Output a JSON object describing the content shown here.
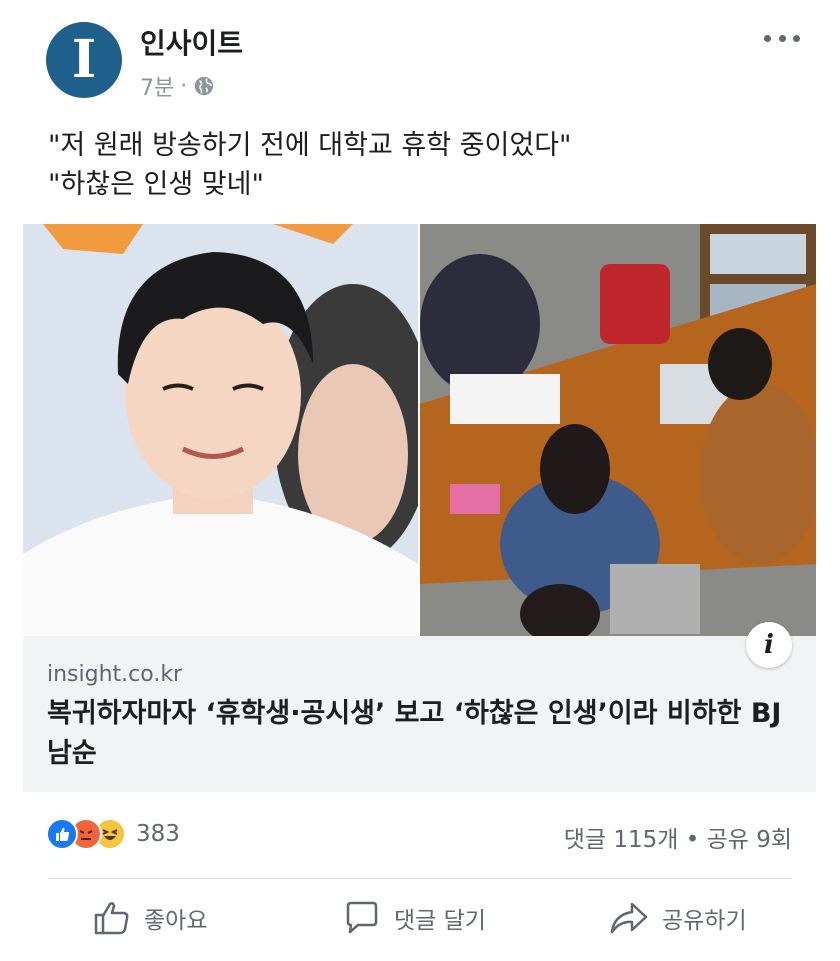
{
  "post": {
    "page_name": "인사이트",
    "avatar_letter": "I",
    "time": "7분",
    "privacy_icon": "globe-icon",
    "text": "\"저 원래 방송하기 전에 대학교 휴학 중이었다\"\n\"하찮은 인생 맞네\""
  },
  "link": {
    "domain": "insight.co.kr",
    "headline": "복귀하자마자 ‘휴학생·공시생’ 보고 ‘하찮은 인생’이라 비하한 BJ 남순",
    "info_icon": "i"
  },
  "stats": {
    "reaction_icons": [
      "like-icon",
      "angry-icon",
      "haha-icon"
    ],
    "reaction_count": "383",
    "comments_shares": "댓글 115개 • 공유 9회"
  },
  "actions": {
    "like": "좋아요",
    "comment": "댓글 달기",
    "share": "공유하기"
  },
  "colors": {
    "avatar_bg": "#1e5f8c",
    "like_blue": "#1877f2",
    "angry_orange": "#f0653b",
    "haha_yellow": "#f7c53c",
    "card_bg": "#f2f3f5",
    "muted_text": "#606770"
  }
}
